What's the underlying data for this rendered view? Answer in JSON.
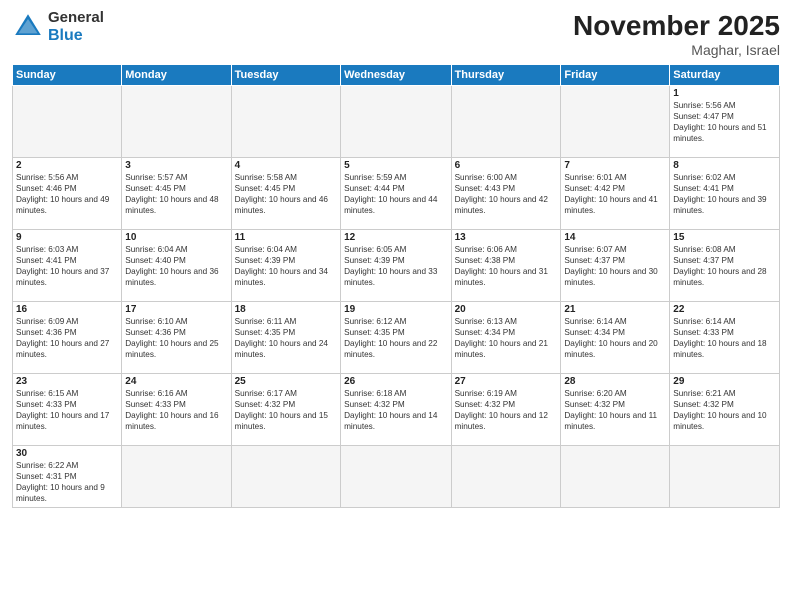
{
  "logo": {
    "text_general": "General",
    "text_blue": "Blue"
  },
  "header": {
    "month": "November 2025",
    "location": "Maghar, Israel"
  },
  "weekdays": [
    "Sunday",
    "Monday",
    "Tuesday",
    "Wednesday",
    "Thursday",
    "Friday",
    "Saturday"
  ],
  "weeks": [
    [
      {
        "day": "",
        "info": ""
      },
      {
        "day": "",
        "info": ""
      },
      {
        "day": "",
        "info": ""
      },
      {
        "day": "",
        "info": ""
      },
      {
        "day": "",
        "info": ""
      },
      {
        "day": "",
        "info": ""
      },
      {
        "day": "1",
        "info": "Sunrise: 5:56 AM\nSunset: 4:47 PM\nDaylight: 10 hours and 51 minutes."
      }
    ],
    [
      {
        "day": "2",
        "info": "Sunrise: 5:56 AM\nSunset: 4:46 PM\nDaylight: 10 hours and 49 minutes."
      },
      {
        "day": "3",
        "info": "Sunrise: 5:57 AM\nSunset: 4:45 PM\nDaylight: 10 hours and 48 minutes."
      },
      {
        "day": "4",
        "info": "Sunrise: 5:58 AM\nSunset: 4:45 PM\nDaylight: 10 hours and 46 minutes."
      },
      {
        "day": "5",
        "info": "Sunrise: 5:59 AM\nSunset: 4:44 PM\nDaylight: 10 hours and 44 minutes."
      },
      {
        "day": "6",
        "info": "Sunrise: 6:00 AM\nSunset: 4:43 PM\nDaylight: 10 hours and 42 minutes."
      },
      {
        "day": "7",
        "info": "Sunrise: 6:01 AM\nSunset: 4:42 PM\nDaylight: 10 hours and 41 minutes."
      },
      {
        "day": "8",
        "info": "Sunrise: 6:02 AM\nSunset: 4:41 PM\nDaylight: 10 hours and 39 minutes."
      }
    ],
    [
      {
        "day": "9",
        "info": "Sunrise: 6:03 AM\nSunset: 4:41 PM\nDaylight: 10 hours and 37 minutes."
      },
      {
        "day": "10",
        "info": "Sunrise: 6:04 AM\nSunset: 4:40 PM\nDaylight: 10 hours and 36 minutes."
      },
      {
        "day": "11",
        "info": "Sunrise: 6:04 AM\nSunset: 4:39 PM\nDaylight: 10 hours and 34 minutes."
      },
      {
        "day": "12",
        "info": "Sunrise: 6:05 AM\nSunset: 4:39 PM\nDaylight: 10 hours and 33 minutes."
      },
      {
        "day": "13",
        "info": "Sunrise: 6:06 AM\nSunset: 4:38 PM\nDaylight: 10 hours and 31 minutes."
      },
      {
        "day": "14",
        "info": "Sunrise: 6:07 AM\nSunset: 4:37 PM\nDaylight: 10 hours and 30 minutes."
      },
      {
        "day": "15",
        "info": "Sunrise: 6:08 AM\nSunset: 4:37 PM\nDaylight: 10 hours and 28 minutes."
      }
    ],
    [
      {
        "day": "16",
        "info": "Sunrise: 6:09 AM\nSunset: 4:36 PM\nDaylight: 10 hours and 27 minutes."
      },
      {
        "day": "17",
        "info": "Sunrise: 6:10 AM\nSunset: 4:36 PM\nDaylight: 10 hours and 25 minutes."
      },
      {
        "day": "18",
        "info": "Sunrise: 6:11 AM\nSunset: 4:35 PM\nDaylight: 10 hours and 24 minutes."
      },
      {
        "day": "19",
        "info": "Sunrise: 6:12 AM\nSunset: 4:35 PM\nDaylight: 10 hours and 22 minutes."
      },
      {
        "day": "20",
        "info": "Sunrise: 6:13 AM\nSunset: 4:34 PM\nDaylight: 10 hours and 21 minutes."
      },
      {
        "day": "21",
        "info": "Sunrise: 6:14 AM\nSunset: 4:34 PM\nDaylight: 10 hours and 20 minutes."
      },
      {
        "day": "22",
        "info": "Sunrise: 6:14 AM\nSunset: 4:33 PM\nDaylight: 10 hours and 18 minutes."
      }
    ],
    [
      {
        "day": "23",
        "info": "Sunrise: 6:15 AM\nSunset: 4:33 PM\nDaylight: 10 hours and 17 minutes."
      },
      {
        "day": "24",
        "info": "Sunrise: 6:16 AM\nSunset: 4:33 PM\nDaylight: 10 hours and 16 minutes."
      },
      {
        "day": "25",
        "info": "Sunrise: 6:17 AM\nSunset: 4:32 PM\nDaylight: 10 hours and 15 minutes."
      },
      {
        "day": "26",
        "info": "Sunrise: 6:18 AM\nSunset: 4:32 PM\nDaylight: 10 hours and 14 minutes."
      },
      {
        "day": "27",
        "info": "Sunrise: 6:19 AM\nSunset: 4:32 PM\nDaylight: 10 hours and 12 minutes."
      },
      {
        "day": "28",
        "info": "Sunrise: 6:20 AM\nSunset: 4:32 PM\nDaylight: 10 hours and 11 minutes."
      },
      {
        "day": "29",
        "info": "Sunrise: 6:21 AM\nSunset: 4:32 PM\nDaylight: 10 hours and 10 minutes."
      }
    ],
    [
      {
        "day": "30",
        "info": "Sunrise: 6:22 AM\nSunset: 4:31 PM\nDaylight: 10 hours and 9 minutes."
      },
      {
        "day": "",
        "info": ""
      },
      {
        "day": "",
        "info": ""
      },
      {
        "day": "",
        "info": ""
      },
      {
        "day": "",
        "info": ""
      },
      {
        "day": "",
        "info": ""
      },
      {
        "day": "",
        "info": ""
      }
    ]
  ]
}
